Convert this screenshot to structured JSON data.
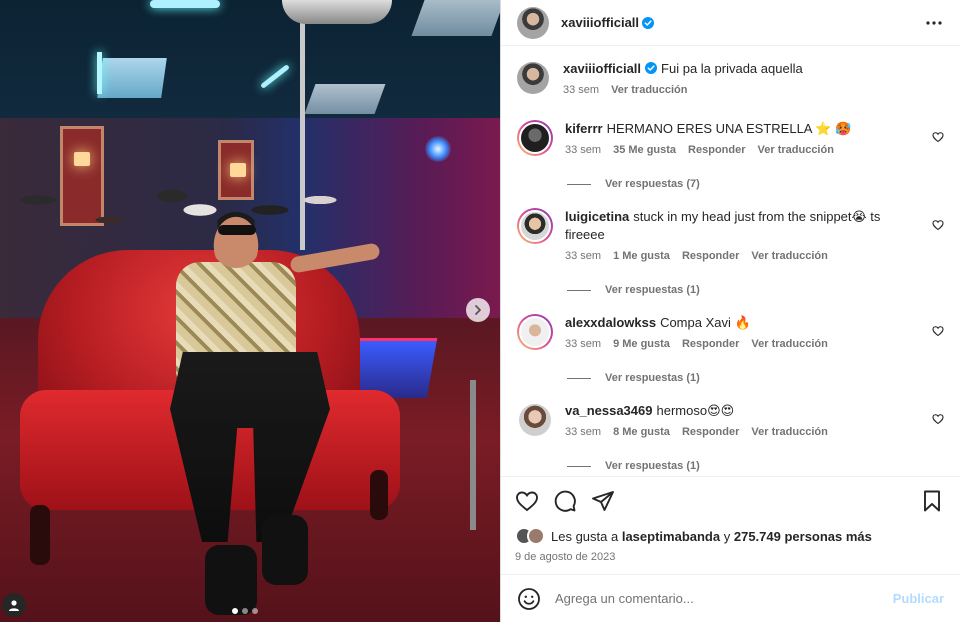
{
  "post": {
    "author": "xaviiiofficiall",
    "caption": "Fui pa la privada aquella",
    "caption_time": "33 sem",
    "translate_label": "Ver traducción"
  },
  "comments": [
    {
      "user": "kiferrr",
      "text": "HERMANO ERES UNA ESTRELLA ⭐ 🥵",
      "time": "33 sem",
      "likes": "35 Me gusta",
      "reply": "Responder",
      "translate": "Ver traducción",
      "replies": "Ver respuestas (7)"
    },
    {
      "user": "luigicetina",
      "text": "stuck in my head just from the snippet😭 ts fireeee",
      "time": "33 sem",
      "likes": "1 Me gusta",
      "reply": "Responder",
      "translate": "Ver traducción",
      "replies": "Ver respuestas (1)"
    },
    {
      "user": "alexxdalowkss",
      "text": "Compa Xavi 🔥",
      "time": "33 sem",
      "likes": "9 Me gusta",
      "reply": "Responder",
      "translate": "Ver traducción",
      "replies": "Ver respuestas (1)"
    },
    {
      "user": "va_nessa3469",
      "text": "hermoso😍😍",
      "time": "33 sem",
      "likes": "8 Me gusta",
      "reply": "Responder",
      "translate": "Ver traducción",
      "replies": "Ver respuestas (1)"
    }
  ],
  "likes": {
    "prefix": "Les gusta a",
    "user": "laseptimabanda",
    "connector": "y",
    "others": "275.749 personas más"
  },
  "date": "9 de agosto de 2023",
  "composer": {
    "placeholder": "Agrega un comentario...",
    "publish_label": "Publicar"
  },
  "icons": {
    "header_more": "more-horizontal-icon",
    "verified": "verified-badge-icon",
    "like": "heart-icon",
    "comment": "comment-icon",
    "share": "send-icon",
    "save": "bookmark-icon",
    "emoji": "emoji-icon",
    "next": "chevron-right-icon",
    "tags": "user-tag-icon"
  },
  "colors": {
    "verified": "#0095f6",
    "publish_disabled": "#b3dbff",
    "secondary_text": "#737373"
  },
  "carousel": {
    "slides": 3,
    "active": 1
  }
}
